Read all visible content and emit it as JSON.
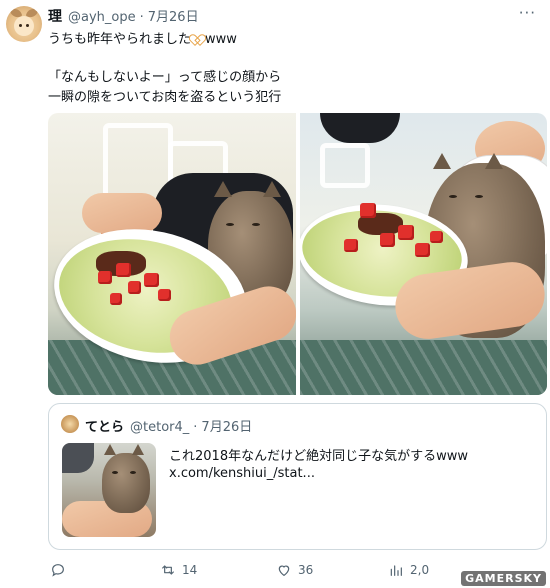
{
  "tweet": {
    "display_name": "理",
    "handle": "@ayh_ope",
    "separator": "·",
    "date": "7月26日",
    "more_icon": "ellipsis-icon",
    "text_line1_before_heart": "うちも昨年やられました",
    "heart_icon": "heart-outline-icon",
    "text_line1_after_heart": "www",
    "text_line2": "「なんもしないよー」って感じの顔から",
    "text_line3": "一瞬の隙をついてお肉を盗るという犯行"
  },
  "quote": {
    "display_name": "てとら",
    "handle": "@tetor4_",
    "separator": "·",
    "date": "7月26日",
    "text_line1": "これ2018年なんだけど絶対同じ子な気がするwww",
    "text_line2": "x.com/kenshiui_/stat..."
  },
  "actions": {
    "reply_count": "",
    "retweet_count": "14",
    "like_count": "36",
    "view_count": "2,0"
  },
  "watermark": "GAMERSKY",
  "colors": {
    "text": "#0f1419",
    "secondary": "#536471",
    "border": "#cfd9de"
  }
}
